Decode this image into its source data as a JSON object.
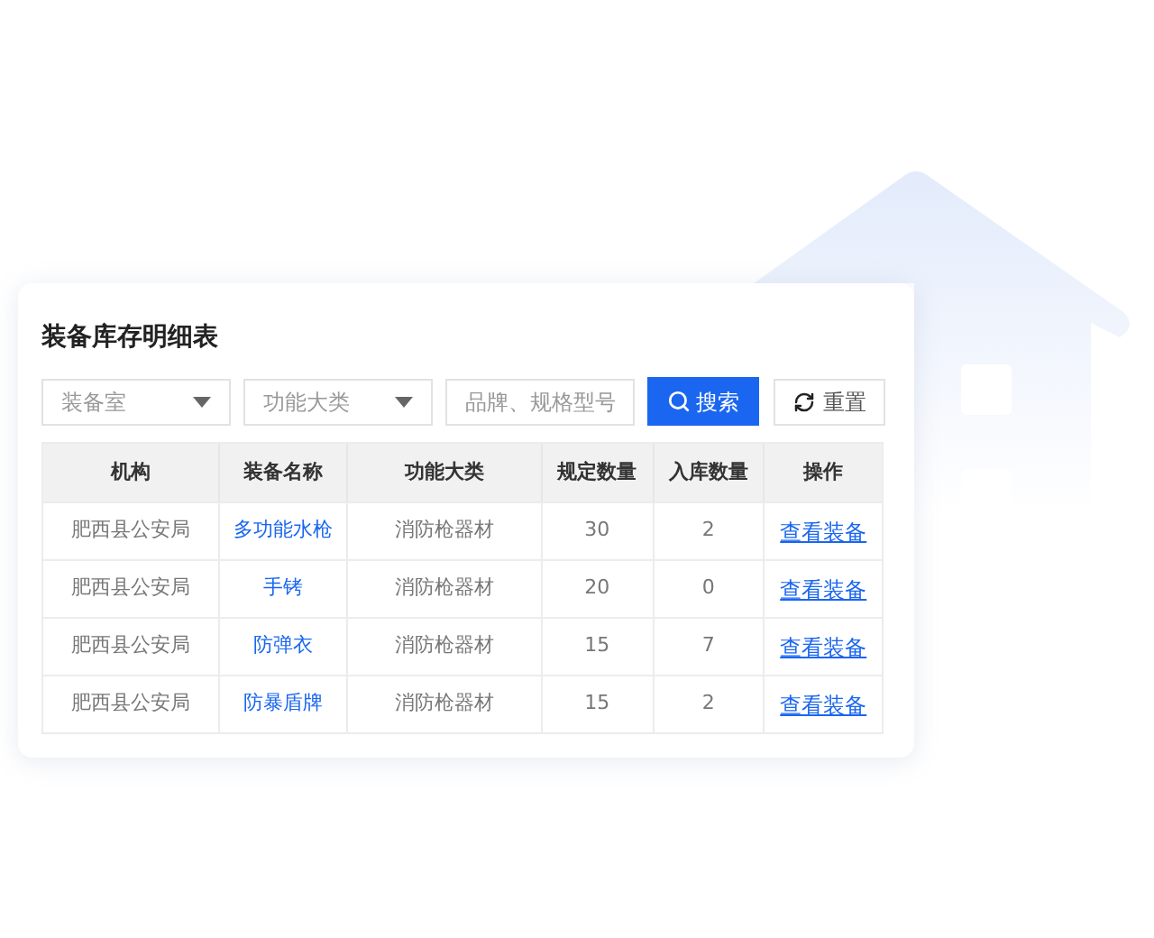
{
  "title": "装备库存明细表",
  "filters": [
    {
      "kind": "select",
      "placeholder": "装备室"
    },
    {
      "kind": "select",
      "placeholder": "功能大类"
    },
    {
      "kind": "input",
      "placeholder": "品牌、规格型号"
    }
  ],
  "search_button": "搜索",
  "reset_button": "重置",
  "table": {
    "columns": [
      "机构",
      "装备名称",
      "功能大类",
      "规定数量",
      "入库数量",
      "操作"
    ],
    "rows": [
      [
        "肥西县公安局",
        "多功能水枪",
        "消防枪器材",
        "30",
        "2",
        "查看装备"
      ],
      [
        "肥西县公安局",
        "手铐",
        "消防枪器材",
        "20",
        "0",
        "查看装备"
      ],
      [
        "肥西县公安局",
        "防弹衣",
        "消防枪器材",
        "15",
        "7",
        "查看装备"
      ],
      [
        "肥西县公安局",
        "防暴盾牌",
        "消防枪器材",
        "15",
        "2",
        "查看装备"
      ]
    ]
  }
}
